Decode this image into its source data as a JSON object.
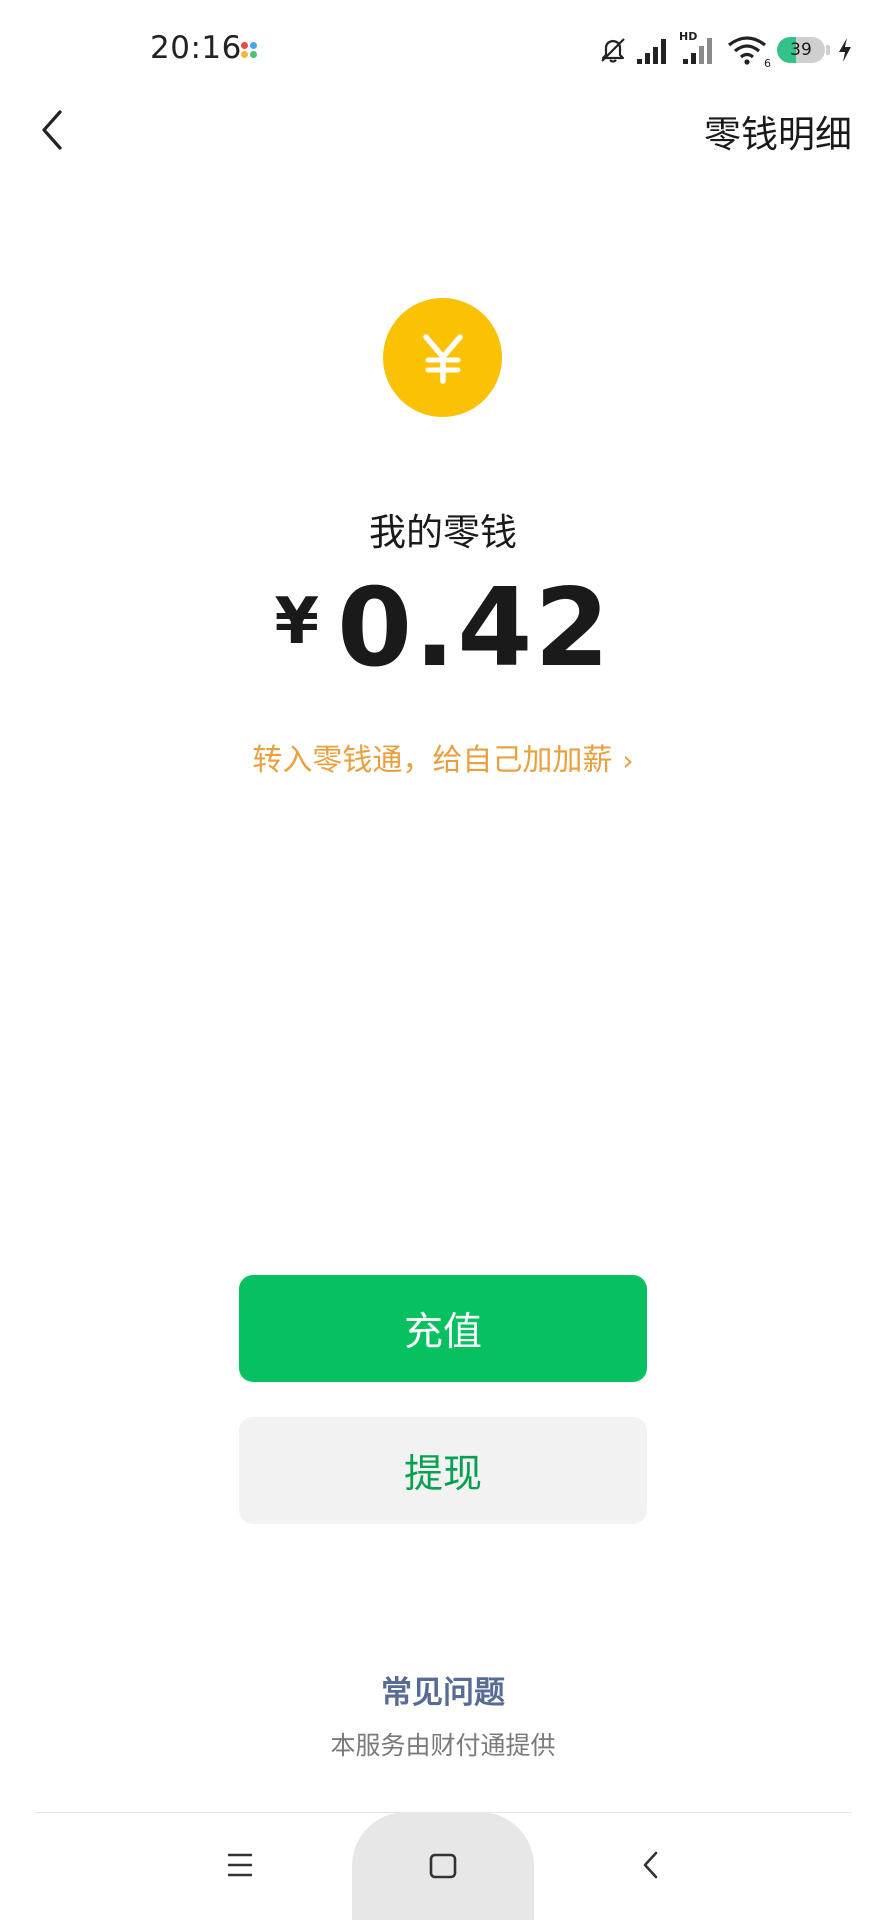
{
  "status_bar": {
    "time": "20:16",
    "hd_label": "HD",
    "wifi_badge": "6",
    "battery_level": "39",
    "battery_fraction": 0.39,
    "icons": [
      "mute-bell-icon",
      "signal-icon",
      "signal-hd-icon",
      "wifi-icon",
      "battery-icon",
      "charging-icon"
    ]
  },
  "header": {
    "back_icon": "chevron-left-icon",
    "detail_link": "零钱明细"
  },
  "wallet": {
    "coin_symbol": "¥",
    "balance_label": "我的零钱",
    "currency_symbol": "¥",
    "amount": "0.42",
    "promo_text": "转入零钱通，给自己加加薪",
    "promo_chevron": "›"
  },
  "actions": {
    "recharge_label": "充值",
    "withdraw_label": "提现"
  },
  "footer": {
    "faq_label": "常见问题",
    "provider_text": "本服务由财付通提供"
  },
  "nav_bar": {
    "icons": [
      "menu-icon",
      "home-icon",
      "back-icon"
    ]
  },
  "colors": {
    "brand_green": "#07c160",
    "coin_yellow": "#fac203",
    "promo_orange": "#e8a13e",
    "link_blue": "#576b95"
  }
}
